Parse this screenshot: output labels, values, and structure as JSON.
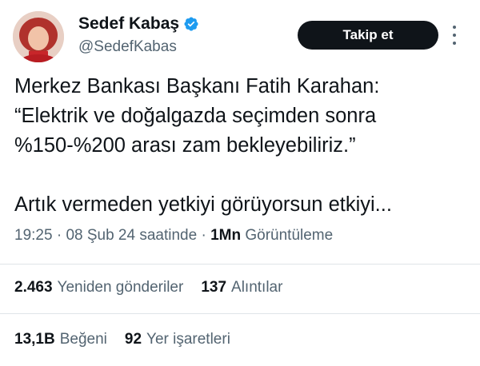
{
  "author": {
    "name": "Sedef Kabaş",
    "handle": "@SedefKabas",
    "verified_color": "#1d9bf0"
  },
  "follow_button": {
    "label": "Takip et"
  },
  "more_icon": "more-vertical-icon",
  "tweet": {
    "lines": [
      "Merkez Bankası Başkanı Fatih Karahan:",
      "“Elektrik ve doğalgazda seçimden sonra",
      "%150-%200 arası zam bekleyebiliriz.”",
      "",
      "Artık vermeden yetkiyi görüyorsun etkiyi..."
    ]
  },
  "meta": {
    "time": "19:25",
    "date": "08 Şub 24 saatinde",
    "views_count": "1Mn",
    "views_label": "Görüntüleme",
    "separator": "·"
  },
  "stats": {
    "reposts_count": "2.463",
    "reposts_label": "Yeniden gönderiler",
    "quotes_count": "137",
    "quotes_label": "Alıntılar",
    "likes_count": "13,1B",
    "likes_label": "Beğeni",
    "bookmarks_count": "92",
    "bookmarks_label": "Yer işaretleri"
  },
  "colors": {
    "text": "#0f1419",
    "secondary": "#536471",
    "divider": "#dfe4e8",
    "button_bg": "#0f1419"
  }
}
